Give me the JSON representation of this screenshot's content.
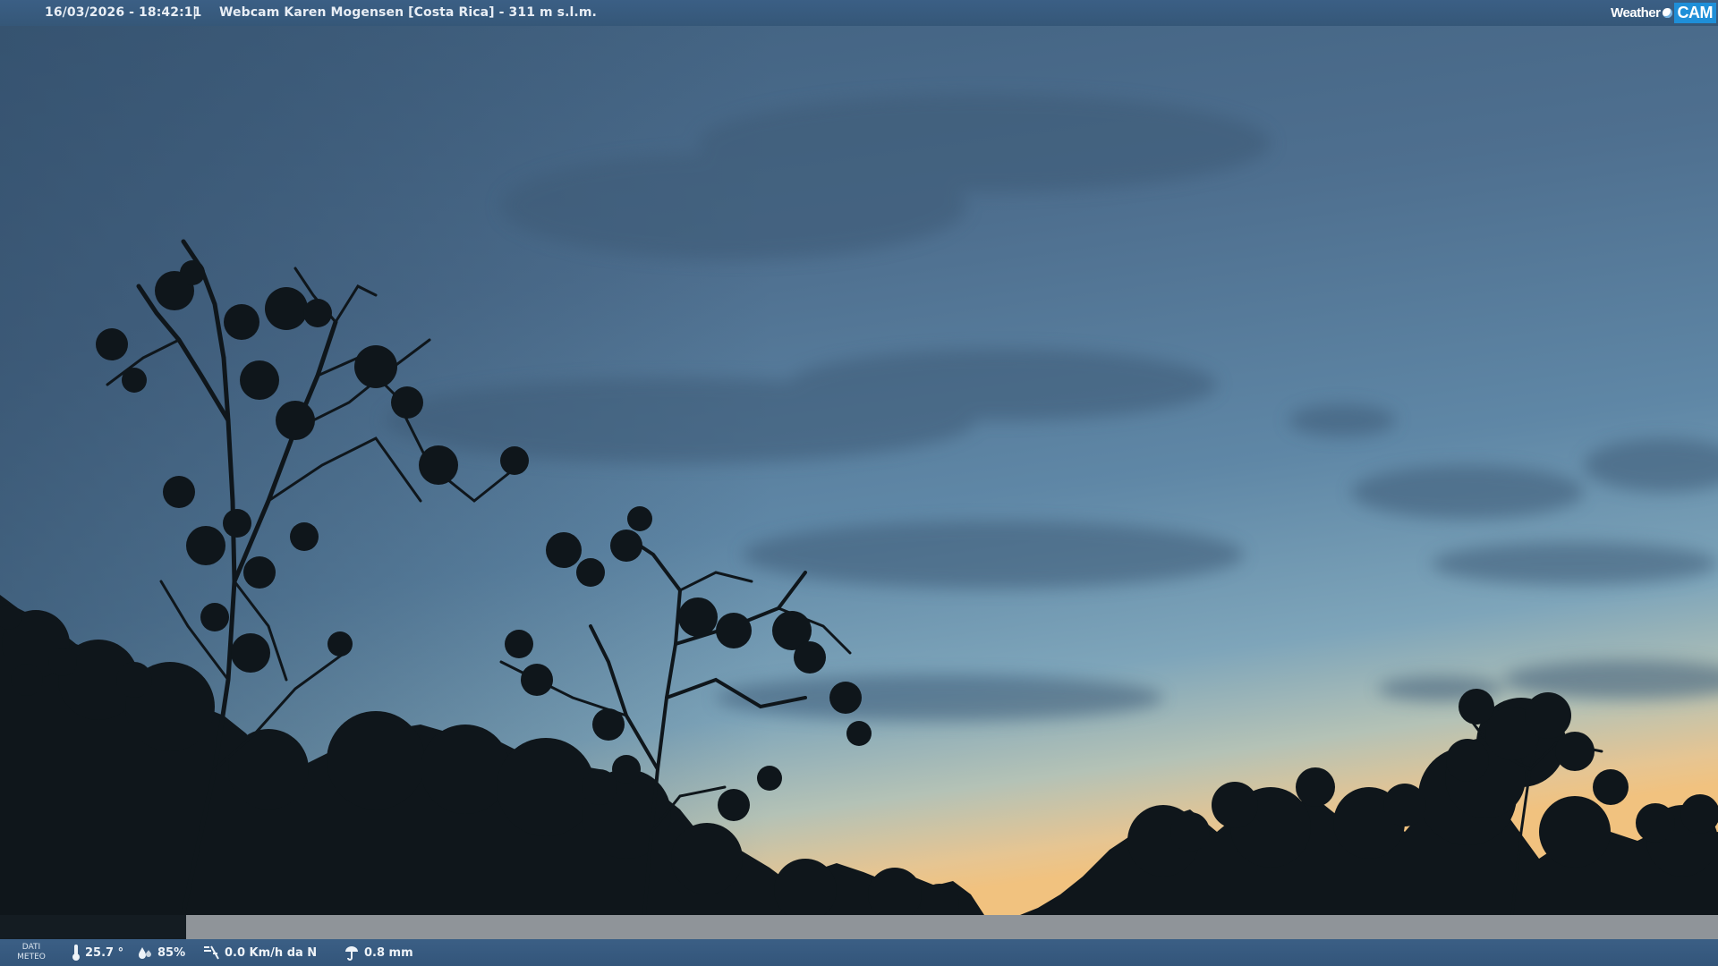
{
  "topbar": {
    "timestamp": "16/03/2026 - 18:42:11",
    "separator": "|",
    "title": "Webcam Karen Mogensen [Costa Rica]  - 311 m s.l.m."
  },
  "logo": {
    "word": "Weather",
    "cam": "CAM"
  },
  "bottombar": {
    "label_line1": "DATI",
    "label_line2": "METEO",
    "temperature": "25.7 °",
    "humidity": "85%",
    "wind": "0.0 Km/h da N",
    "rain": "0.8 mm"
  },
  "icons": {
    "temperature": "thermometer-icon",
    "humidity": "humidity-drops-icon",
    "wind": "wind-vane-icon",
    "rain": "rain-gauge-icon"
  },
  "colors": {
    "bar": "#3b5f85",
    "sky_top": "#3f607f",
    "sky_horizon": "#f3c78a",
    "silhouette": "#0f161b"
  }
}
